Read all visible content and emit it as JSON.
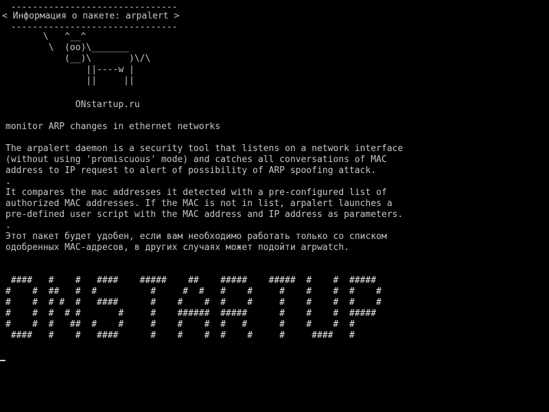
{
  "terminal": {
    "cowsay": {
      "border_top": " -------------------------------",
      "title": "< Информация о пакете: arpalert >",
      "border_bottom": " -------------------------------",
      "cow": "       \\   ^__^\n        \\  (oo)\\_______\n           (__)\\       )\\/\\\n               ||----w |\n               ||     ||"
    },
    "credit": "             ONstartup.ru",
    "short_description": "monitor ARP changes in ethernet networks",
    "long_description": "The arpalert daemon is a security tool that listens on a network interface\n(without using 'promiscuous' mode) and catches all conversations of MAC\naddress to IP request to alert of possibility of ARP spoofing attack.\n.\nIt compares the mac addresses it detected with a pre-configured list of\nauthorized MAC addresses. If the MAC is not in list, arpalert launches a\npre-defined user script with the MAC address and IP address as parameters.\n.\nЭтот пакет будет удобен, если вам необходимо работать только со списком\nодобренных МАС-адресов, в других случаях может подойти arpwatch.",
    "banner": " ####   #    #   ####    #####    ##    #####    #####  #    #  #####\n#    #  ##   #  #          #     #  #   #    #     #    #    #  #    #\n#    #  # #  #   ####      #    #    #  #    #     #    #    #  #    #\n#    #  #  # #       #     #    ######  #####      #    #    #  #####\n#    #  #   ##  #    #     #    #    #  #   #      #    #    #  #\n ####   #    #   ####      #    #    #  #    #     #     ####   #",
    "cursor_symbol": "_"
  }
}
